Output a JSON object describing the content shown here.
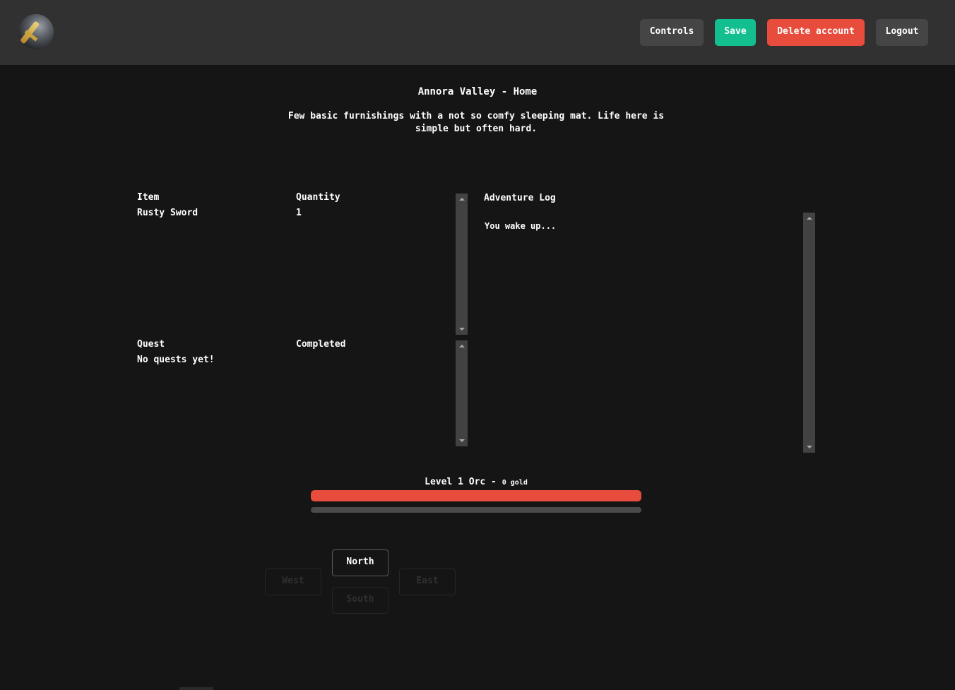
{
  "header": {
    "logo_icon": "sword-emblem-icon",
    "buttons": {
      "controls": "Controls",
      "save": "Save",
      "delete_account": "Delete account",
      "logout": "Logout"
    }
  },
  "location": {
    "title": "Annora Valley - Home",
    "description": "Few basic furnishings with a not so comfy sleeping mat. Life here is simple but often hard."
  },
  "inventory": {
    "headers": {
      "item": "Item",
      "quantity": "Quantity"
    },
    "rows": [
      {
        "item": "Rusty Sword",
        "quantity": "1"
      }
    ]
  },
  "quests": {
    "headers": {
      "quest": "Quest",
      "completed": "Completed"
    },
    "rows": [
      {
        "quest": "No quests yet!",
        "completed": ""
      }
    ]
  },
  "adventure_log": {
    "title": "Adventure Log",
    "entries": [
      "You wake up..."
    ]
  },
  "player": {
    "summary": "Level 1 Orc -",
    "gold": "0 gold",
    "health_fraction": 1.0,
    "xp_fraction": 0.0
  },
  "movement": {
    "north": "North",
    "west": "West",
    "east": "East",
    "south": "South"
  },
  "colors": {
    "accent_green": "#13bf8e",
    "danger_red": "#e74c3c",
    "background": "#151515",
    "topbar": "#313131"
  }
}
